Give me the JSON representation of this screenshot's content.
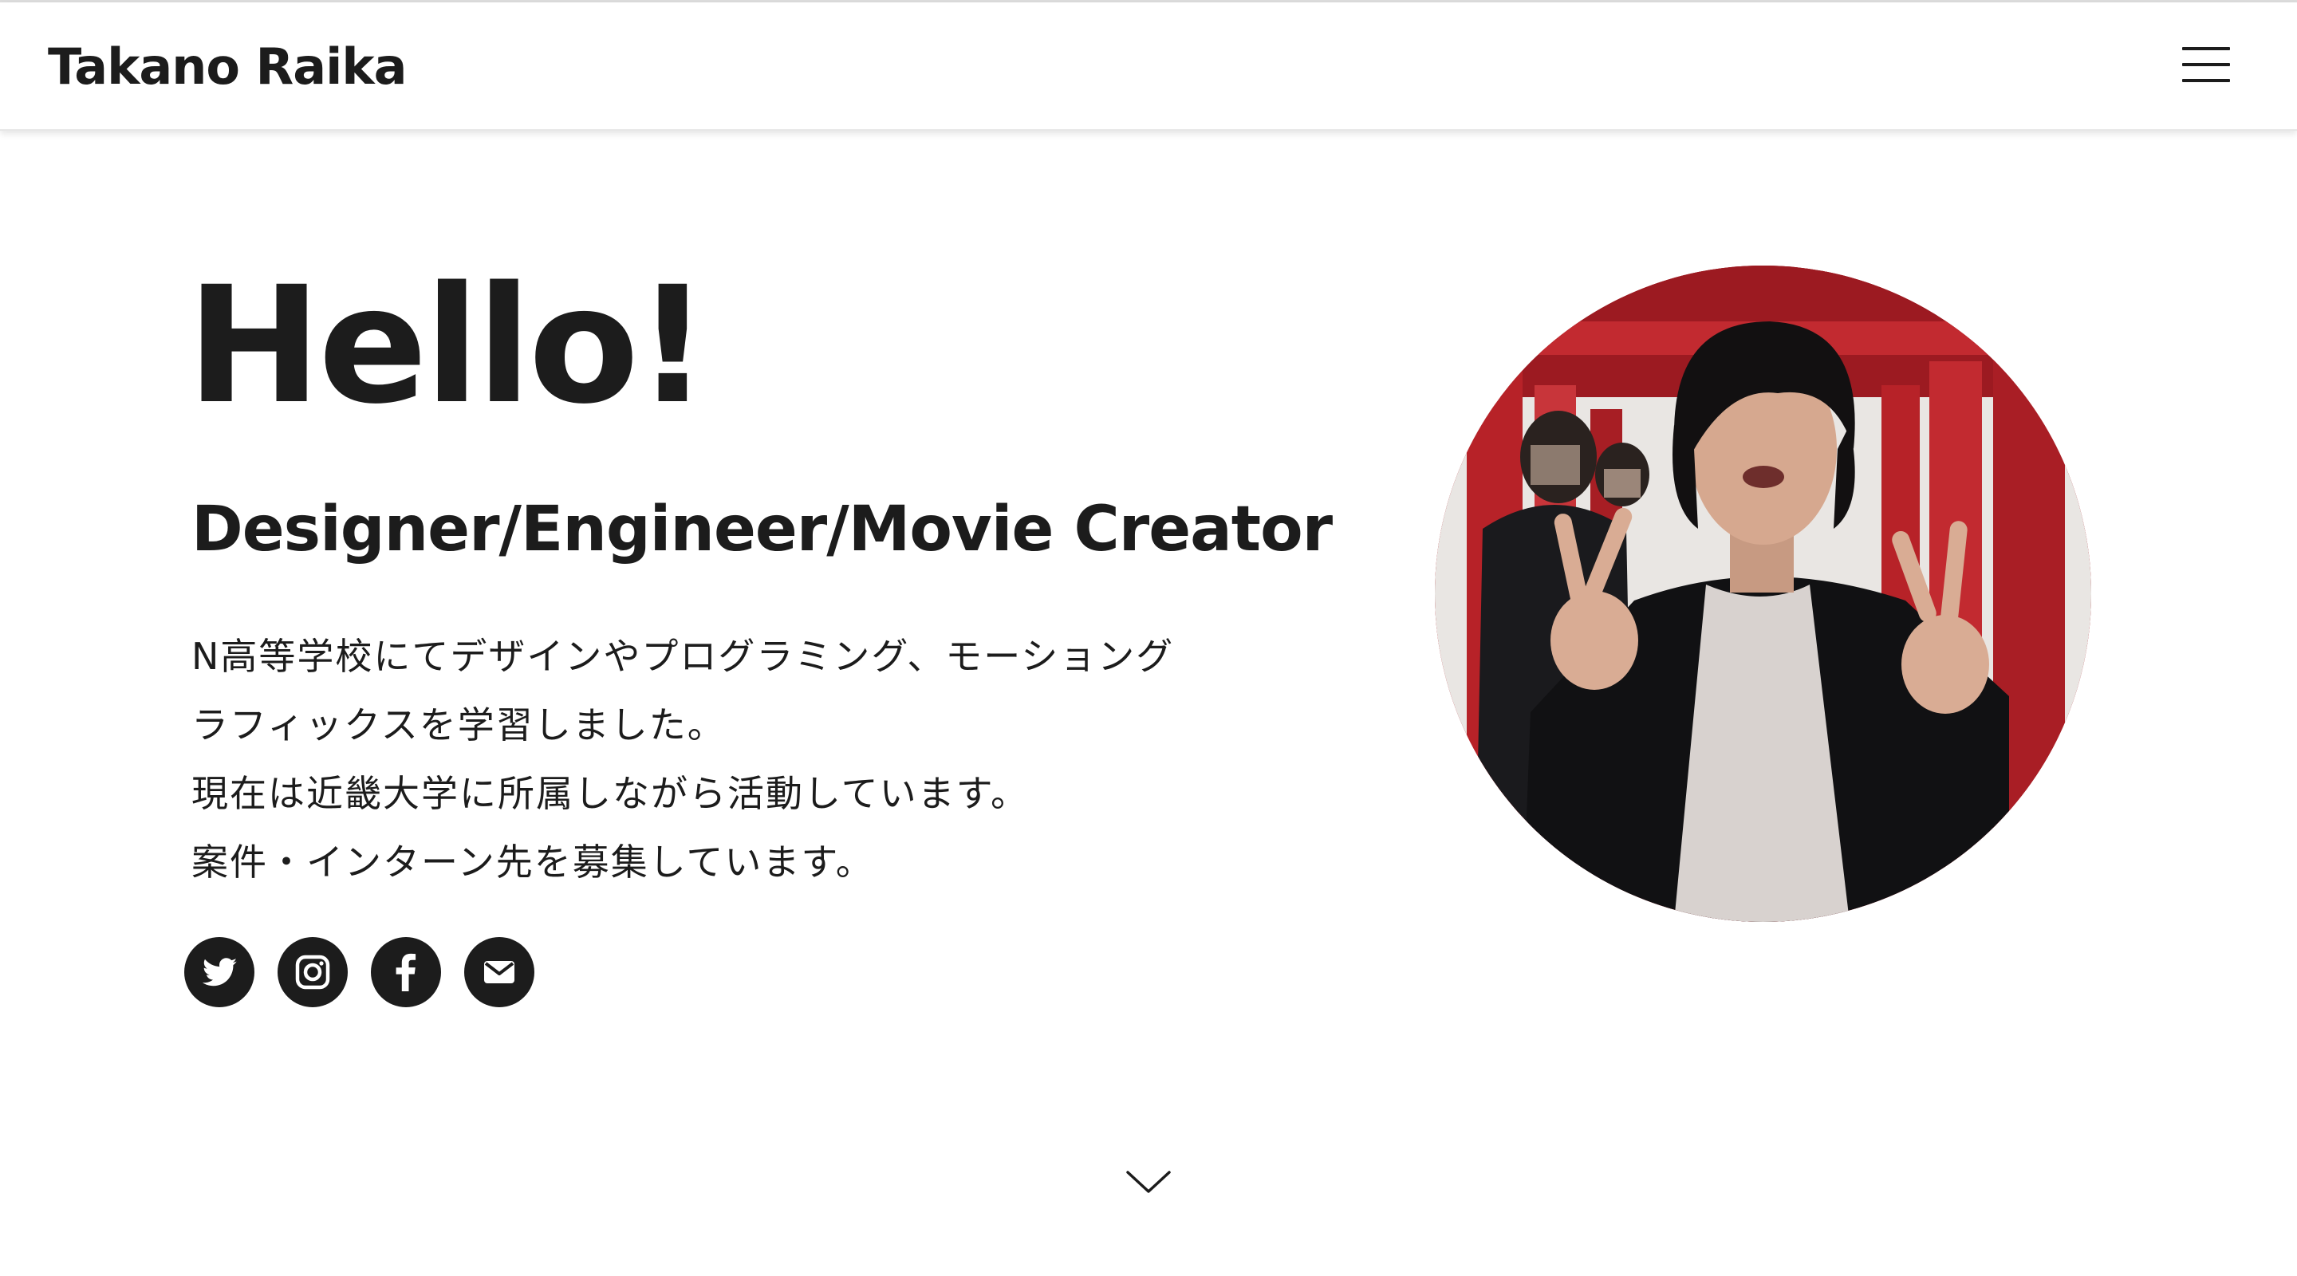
{
  "header": {
    "site_title": "Takano Raika",
    "menu_icon": "hamburger-menu-icon"
  },
  "hero": {
    "title": "Hello!",
    "subtitle": "Designer/Engineer/Movie Creator",
    "bio_lines": [
      "N高等学校にてデザインやプログラミング、モーショング",
      "ラフィックスを学習しました。",
      "現在は近畿大学に所属しながら活動しています。",
      "案件・インターン先を募集しています。"
    ]
  },
  "socials": [
    {
      "icon": "twitter-icon"
    },
    {
      "icon": "instagram-icon"
    },
    {
      "icon": "facebook-icon"
    },
    {
      "icon": "mail-icon"
    }
  ],
  "profile_photo": {
    "icon": "profile-photo"
  },
  "scroll_indicator": {
    "icon": "chevron-down-icon"
  },
  "colors": {
    "text": "#1c1c1c",
    "background": "#ffffff",
    "photo_accent": "#b8232a"
  }
}
